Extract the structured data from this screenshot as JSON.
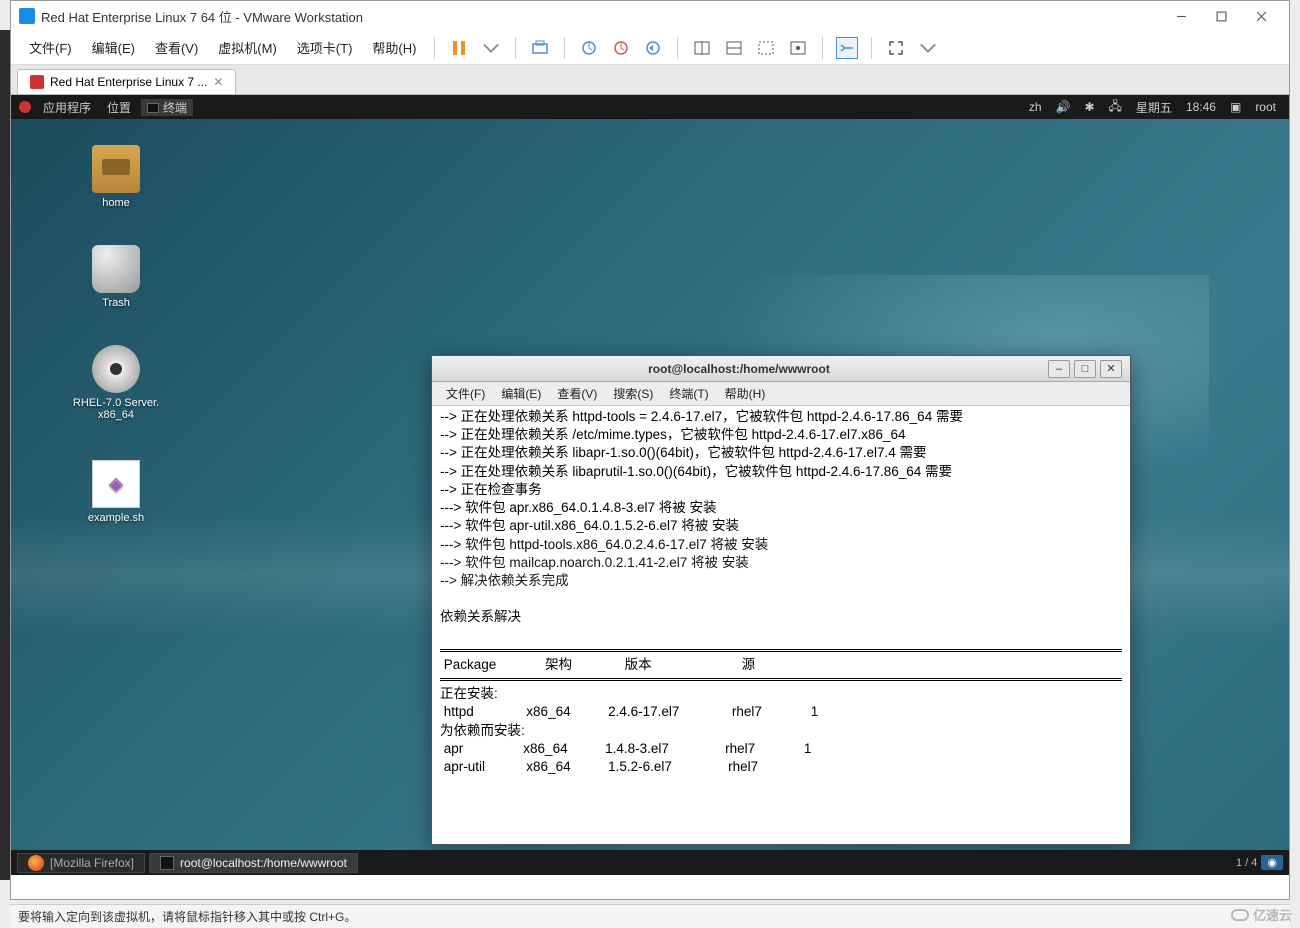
{
  "vmware": {
    "title": "Red Hat Enterprise Linux 7 64 位 - VMware Workstation",
    "menus": [
      "文件(F)",
      "编辑(E)",
      "查看(V)",
      "虚拟机(M)",
      "选项卡(T)",
      "帮助(H)"
    ],
    "tab_label": "Red Hat Enterprise Linux 7 ...",
    "status": "要将输入定向到该虚拟机，请将鼠标指针移入其中或按 Ctrl+G。"
  },
  "gnome": {
    "top": {
      "apps": "应用程序",
      "places": "位置",
      "terminal": "终端",
      "lang": "zh",
      "day": "星期五",
      "time": "18:46",
      "user": "root"
    },
    "desktop_icons": [
      {
        "name": "home",
        "label": "home"
      },
      {
        "name": "trash",
        "label": "Trash"
      },
      {
        "name": "cd",
        "label": "RHEL-7.0 Server.\nx86_64"
      },
      {
        "name": "file",
        "label": "example.sh"
      }
    ],
    "bottom": {
      "firefox": "[Mozilla Firefox]",
      "terminal": "root@localhost:/home/wwwroot",
      "workspace": "1 / 4"
    }
  },
  "terminal": {
    "title": "root@localhost:/home/wwwroot",
    "menus": [
      "文件(F)",
      "编辑(E)",
      "查看(V)",
      "搜索(S)",
      "终端(T)",
      "帮助(H)"
    ],
    "lines_pre": [
      "--> 正在处理依赖关系 httpd-tools = 2.4.6-17.el7，它被软件包 httpd-2.4.6-17.86_64 需要",
      "--> 正在处理依赖关系 /etc/mime.types，它被软件包 httpd-2.4.6-17.el7.x86_64",
      "--> 正在处理依赖关系 libapr-1.so.0()(64bit)，它被软件包 httpd-2.4.6-17.el7.4 需要",
      "--> 正在处理依赖关系 libaprutil-1.so.0()(64bit)，它被软件包 httpd-2.4.6-17.86_64 需要",
      "--> 正在检查事务",
      "---> 软件包 apr.x86_64.0.1.4.8-3.el7 将被 安装",
      "---> 软件包 apr-util.x86_64.0.1.5.2-6.el7 将被 安装",
      "---> 软件包 httpd-tools.x86_64.0.2.4.6-17.el7 将被 安装",
      "---> 软件包 mailcap.noarch.0.2.1.41-2.el7 将被 安装",
      "--> 解决依赖关系完成",
      "",
      "依赖关系解决",
      ""
    ],
    "table_header": " Package             架构              版本                        源",
    "table_body": [
      "正在安装:",
      " httpd              x86_64          2.4.6-17.el7              rhel7             1",
      "为依赖而安装:",
      " apr                x86_64          1.4.8-3.el7               rhel7             1",
      " apr-util           x86_64          1.5.2-6.el7               rhel7"
    ]
  },
  "watermark": "亿速云"
}
